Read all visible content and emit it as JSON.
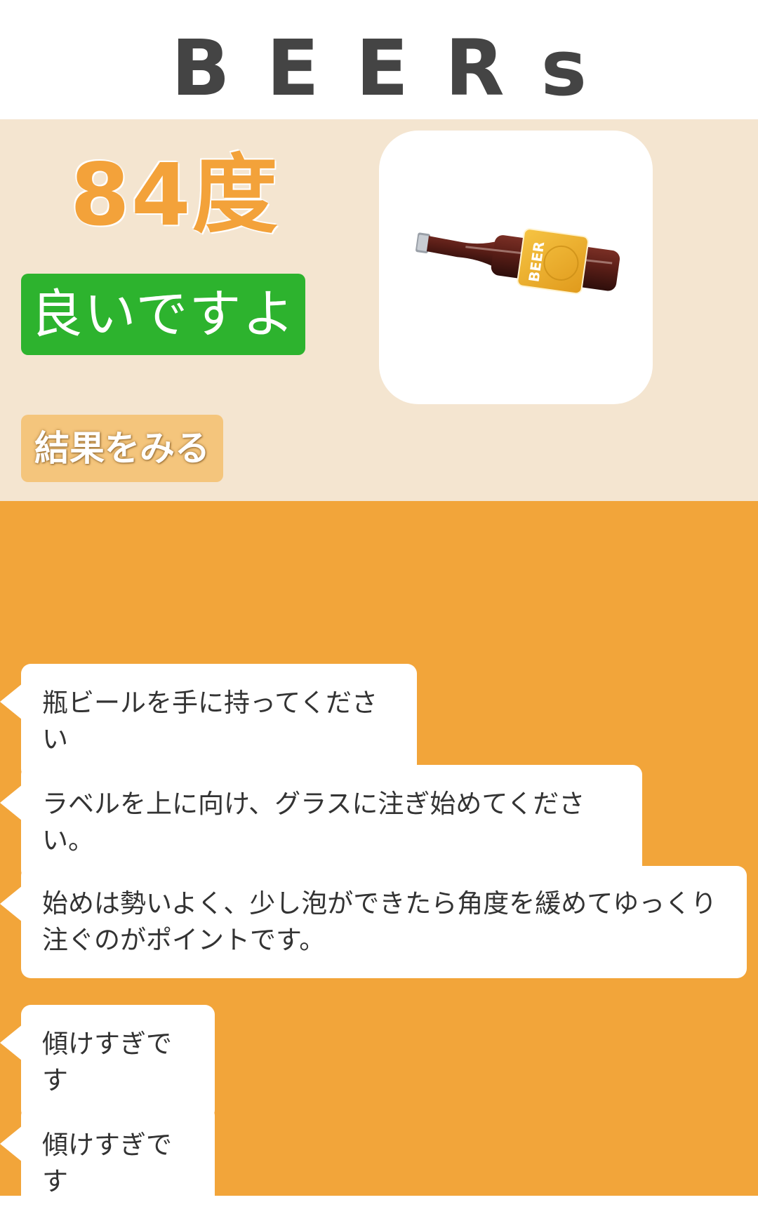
{
  "header": {
    "title": "BEERs"
  },
  "status": {
    "angle_text": "84度",
    "badge_label": "良いですよ",
    "result_button_label": "結果をみる",
    "image_icon": "beer-bottle-icon",
    "bottle_label_text": "BEER"
  },
  "colors": {
    "accent_orange": "#f2a53a",
    "panel_background": "#f4e5d0",
    "status_green": "#2db32e",
    "button_tan": "#f4c57c",
    "title_gray": "#444444"
  },
  "messages": [
    {
      "text": "瓶ビールを手に持ってください"
    },
    {
      "text": "ラベルを上に向け、グラスに注ぎ始めてください。"
    },
    {
      "text": "始めは勢いよく、少し泡ができたら角度を緩めてゆっくり注ぐのがポイントです。"
    },
    {
      "text": "傾けすぎです"
    },
    {
      "text": "傾けすぎです"
    }
  ]
}
